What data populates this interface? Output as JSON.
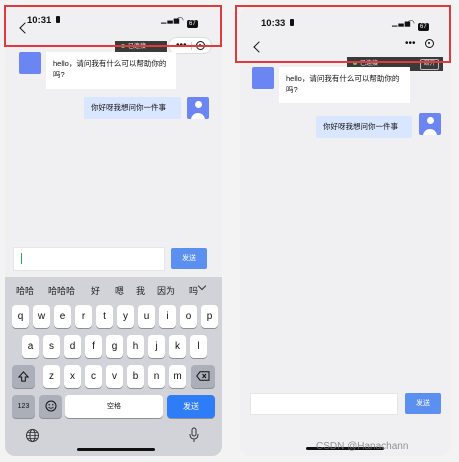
{
  "left": {
    "status": {
      "time": "10:31",
      "signal": "▁▃▅",
      "wifi": "◠",
      "battery": "67"
    },
    "connection": {
      "text": "已连接"
    },
    "messages": [
      {
        "from": "bot",
        "text": "hello，请问我有什么可以帮助你的吗?"
      },
      {
        "from": "user",
        "text": "你好呀我想问你一件事"
      }
    ],
    "input": {
      "value": ""
    },
    "send_label": "发送",
    "candidates": [
      "哈哈",
      "哈哈哈",
      "好",
      "嗯",
      "我",
      "因为",
      "吗"
    ],
    "keyboard": {
      "row1": [
        "q",
        "w",
        "e",
        "r",
        "t",
        "y",
        "u",
        "i",
        "o",
        "p"
      ],
      "row2": [
        "a",
        "s",
        "d",
        "f",
        "g",
        "h",
        "j",
        "k",
        "l"
      ],
      "row3": [
        "z",
        "x",
        "c",
        "v",
        "b",
        "n",
        "m"
      ],
      "num_label": "123",
      "space_label": "空格",
      "send_label": "发送"
    }
  },
  "right": {
    "status": {
      "time": "10:33",
      "signal": "▁▃▅",
      "wifi": "◠",
      "battery": "67"
    },
    "connection": {
      "text": "已连接",
      "disconnect_label": "断开"
    },
    "messages": [
      {
        "from": "bot",
        "text": "hello，请问我有什么可以帮助你的吗?"
      },
      {
        "from": "user",
        "text": "你好呀我想问你一件事"
      }
    ],
    "input": {
      "value": ""
    },
    "send_label": "发送"
  },
  "watermark": "CSDN @Hanachann",
  "colors": {
    "highlight": "#e0393e",
    "accent": "#5b8ff0",
    "avatar": "#6b86f2",
    "user_bubble": "#d9e6ff"
  }
}
